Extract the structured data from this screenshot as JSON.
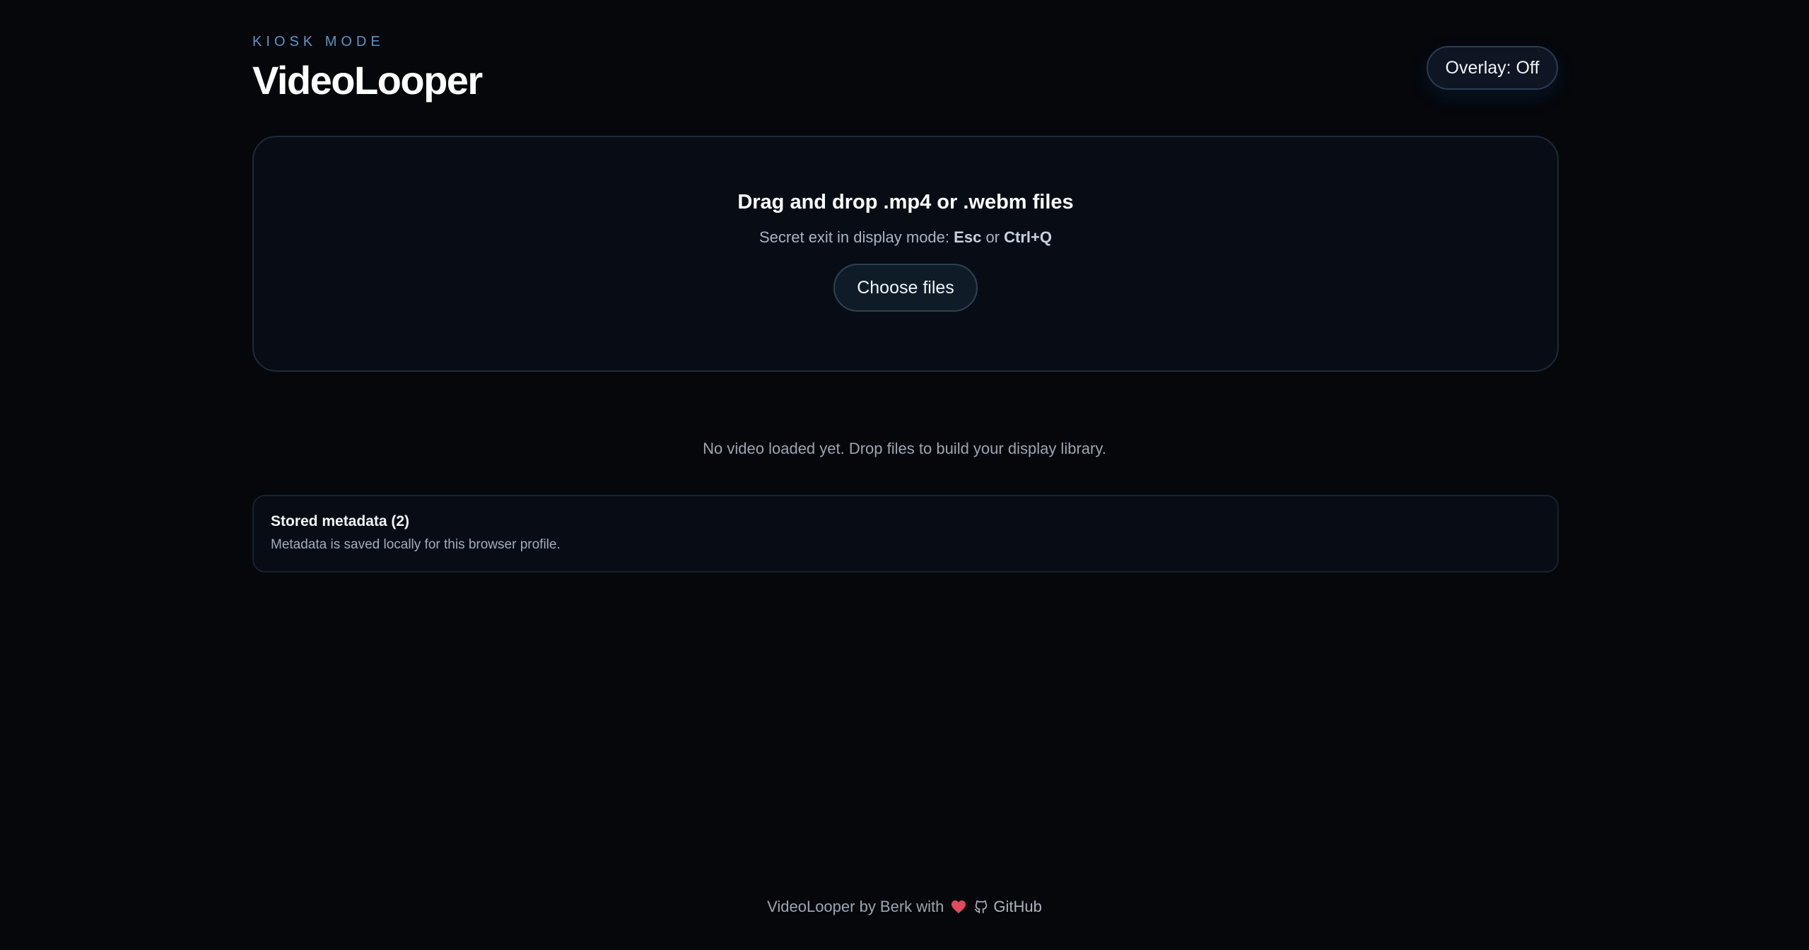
{
  "header": {
    "eyebrow": "KIOSK MODE",
    "title": "VideoLooper",
    "overlay_toggle": "Overlay: Off"
  },
  "dropzone": {
    "title": "Drag and drop .mp4 or .webm files",
    "subtitle_prefix": "Secret exit in display mode:",
    "key_esc": "Esc",
    "subtitle_or": "or",
    "key_ctrlq": "Ctrl+Q",
    "choose_button": "Choose files"
  },
  "library": {
    "empty_message": "No video loaded yet. Drop files to build your display library."
  },
  "metadata": {
    "title": "Stored metadata (2)",
    "description": "Metadata is saved locally for this browser profile."
  },
  "footer": {
    "credit": "VideoLooper by Berk with",
    "heart_icon": "heart-icon",
    "github_icon": "github-icon",
    "github_label": "GitHub"
  },
  "colors": {
    "background": "#05070b",
    "accent": "#5e93c4",
    "heart": "#e0495e"
  }
}
